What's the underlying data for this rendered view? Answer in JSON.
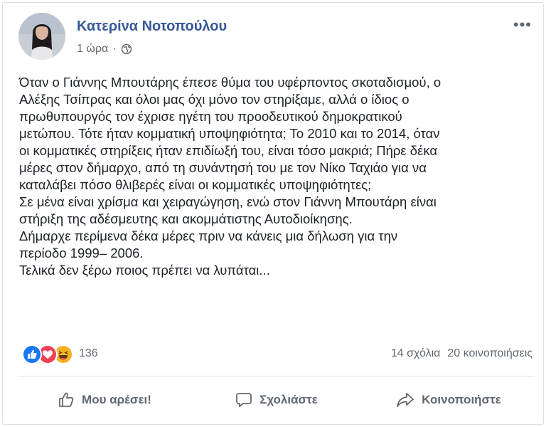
{
  "post": {
    "author": "Κατερίνα Νοτοπούλου",
    "time": "1 ώρα",
    "separator": "·",
    "privacy_icon": "globe-icon",
    "more_label": "•••",
    "text_lines": [
      "Όταν ο Γιάννης Μπουτάρης έπεσε θύμα του υφέρποντος σκοταδισμού, ο",
      "Αλέξης Τσίπρας και όλοι μας όχι μόνο τον στηρίξαμε, αλλά ο ίδιος ο",
      "πρωθυπουργός τον έχρισε ηγέτη του προοδευτικού δημοκρατικού",
      "μετώπου. Τότε ήταν κομματική υποψηφιότητα; Το 2010 και το 2014, όταν",
      "οι κομματικές στηρίξεις ήταν επιδίωξή του, είναι τόσο μακριά; Πήρε δέκα",
      "μέρες στον δήμαρχο, από τη συνάντησή του με τον Νίκο Ταχιάο για να",
      "καταλάβει πόσο θλιβερές είναι οι κομματικές υποψηφιότητες;",
      "Σε μένα είναι χρίσμα και χειραγώγηση, ενώ στον Γιάννη Μπουτάρη είναι",
      "στήριξη της αδέσμευτης και ακομμάτιστης Αυτοδιοίκησης.",
      "Δήμαρχε περίμενα δέκα μέρες πριν να κάνεις μια δήλωση για την",
      "περίοδο 1999– 2006.",
      "Τελικά δεν ξέρω ποιος πρέπει να λυπάται..."
    ]
  },
  "stats": {
    "reactions_count": "136",
    "reaction_icons": [
      "like-icon",
      "love-icon",
      "haha-icon"
    ],
    "comments": "14 σχόλια",
    "shares": "20 κοινοποιήσεις"
  },
  "actions": {
    "like": "Μου αρέσει!",
    "comment": "Σχολιάστε",
    "share": "Κοινοποιήστε"
  },
  "colors": {
    "author": "#365899",
    "secondary": "#606770",
    "like": "#1877f2",
    "love": "#f33e58",
    "haha": "#f7b125"
  }
}
